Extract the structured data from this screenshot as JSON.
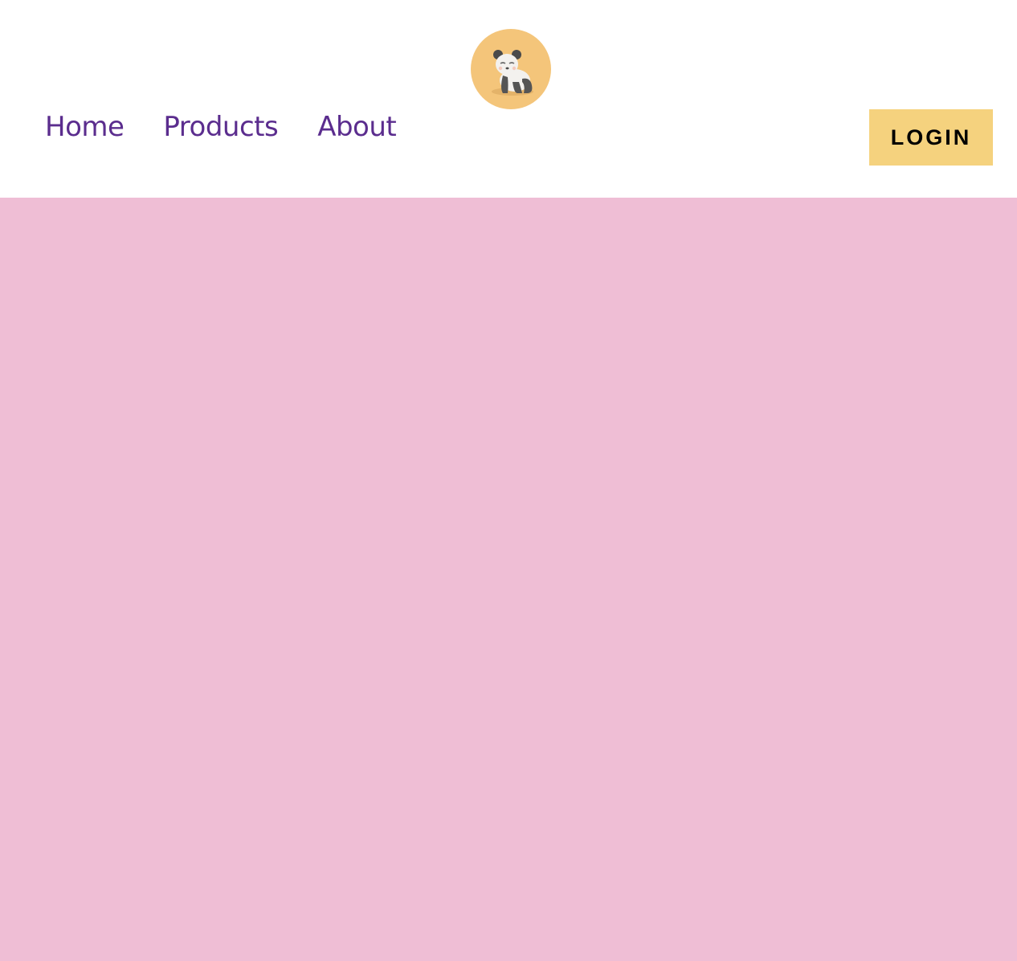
{
  "header": {
    "logo_icon": "panda-logo-icon",
    "nav": {
      "items": [
        {
          "label": "Home"
        },
        {
          "label": "Products"
        },
        {
          "label": "About"
        }
      ]
    },
    "login_label": "LOGIN"
  },
  "colors": {
    "nav_text": "#5b2d8e",
    "login_bg": "#f5d27e",
    "logo_bg": "#f4c57a",
    "hero_bg": "#efbed5"
  }
}
